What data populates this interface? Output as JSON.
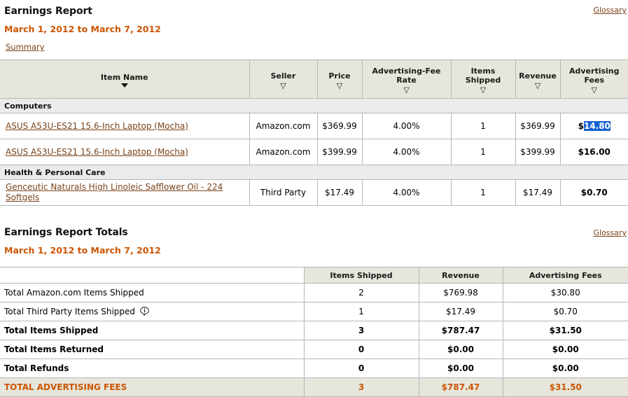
{
  "report": {
    "title": "Earnings Report",
    "date_range": "March 1, 2012 to March 7, 2012",
    "summary_link": "Summary",
    "glossary_link": "Glossary"
  },
  "table": {
    "columns": [
      {
        "label": "Item Name",
        "sort": "active-desc"
      },
      {
        "label": "Seller",
        "sort": "inactive"
      },
      {
        "label": "Price",
        "sort": "inactive"
      },
      {
        "label": "Advertising-Fee Rate",
        "line1": "Advertising-Fee",
        "line2": "Rate",
        "sort": "inactive"
      },
      {
        "label": "Items Shipped",
        "line1": "Items",
        "line2": "Shipped",
        "sort": "inactive"
      },
      {
        "label": "Revenue",
        "sort": "inactive"
      },
      {
        "label": "Advertising Fees",
        "line1": "Advertising",
        "line2": "Fees",
        "sort": "inactive"
      }
    ],
    "groups": [
      {
        "category": "Computers",
        "rows": [
          {
            "item_name": "ASUS A53U-ES21 15.6-Inch Laptop (Mocha)",
            "seller": "Amazon.com",
            "price": "$369.99",
            "fee_rate": "4.00%",
            "items_shipped": "1",
            "revenue": "$369.99",
            "fee_currency": "$",
            "fee_amount": "14.80",
            "fee_selected": true
          },
          {
            "item_name": "ASUS A53U-ES21 15.6-Inch Laptop (Mocha)",
            "seller": "Amazon.com",
            "price": "$399.99",
            "fee_rate": "4.00%",
            "items_shipped": "1",
            "revenue": "$399.99",
            "fee_currency": "$",
            "fee_amount": "16.00",
            "fee_selected": false
          }
        ]
      },
      {
        "category": "Health & Personal Care",
        "rows": [
          {
            "item_name": "Genceutic Naturals High Linoleic Safflower Oil - 224 Softgels",
            "seller": "Third Party",
            "price": "$17.49",
            "fee_rate": "4.00%",
            "items_shipped": "1",
            "revenue": "$17.49",
            "fee_currency": "$",
            "fee_amount": "0.70",
            "fee_selected": false
          }
        ]
      }
    ]
  },
  "totals": {
    "title": "Earnings Report Totals",
    "date_range": "March 1, 2012 to March 7, 2012",
    "glossary_link": "Glossary",
    "columns": [
      "",
      "Items Shipped",
      "Revenue",
      "Advertising Fees"
    ],
    "rows": [
      {
        "label": "Total Amazon.com Items Shipped",
        "items_shipped": "2",
        "revenue": "$769.98",
        "fees": "$30.80",
        "bold": false,
        "info": false
      },
      {
        "label": "Total Third Party Items Shipped",
        "items_shipped": "1",
        "revenue": "$17.49",
        "fees": "$0.70",
        "bold": false,
        "info": true
      },
      {
        "label": "Total Items Shipped",
        "items_shipped": "3",
        "revenue": "$787.47",
        "fees": "$31.50",
        "bold": true,
        "info": false
      },
      {
        "label": "Total Items Returned",
        "items_shipped": "0",
        "revenue": "$0.00",
        "fees": "$0.00",
        "bold": true,
        "info": false
      },
      {
        "label": "Total Refunds",
        "items_shipped": "0",
        "revenue": "$0.00",
        "fees": "$0.00",
        "bold": true,
        "info": false
      }
    ],
    "grand": {
      "label": "TOTAL ADVERTISING FEES",
      "items_shipped": "3",
      "revenue": "$787.47",
      "fees": "$31.50"
    }
  },
  "colors": {
    "accent_orange": "#cc5500",
    "link_brown": "#79431a",
    "header_bg": "#e6e6dc",
    "category_bg": "#ebebeb",
    "selection_blue": "#1461d2",
    "border": "#b7b7b7"
  },
  "icons": {
    "sort_active": "sort-desc-filled-icon",
    "sort_inactive": "sort-desc-hollow-icon",
    "info": "info-bubble-icon"
  }
}
